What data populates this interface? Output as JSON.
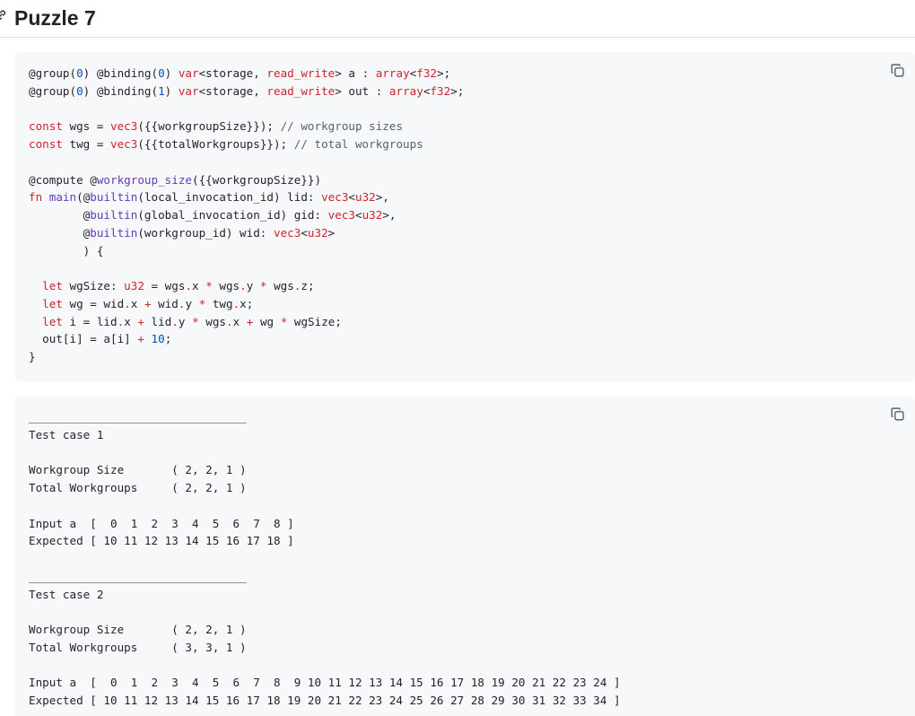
{
  "page": {
    "title": "Puzzle 7"
  },
  "icons": {
    "anchor": "link-icon",
    "copy": "copy-icon"
  },
  "colors": {
    "code_bg": "#f6f8fa",
    "keyword": "#cf222e",
    "function": "#6639ba",
    "comment": "#57606a",
    "number": "#0550ae"
  },
  "code_block_1": {
    "lines": {
      "l1a": "@group(",
      "l1b": "0",
      "l1c": ") @binding(",
      "l1d": "0",
      "l1e": ") ",
      "l1f": "var",
      "l1g": "<storage, ",
      "l1h": "read_write",
      "l1i": "> a : ",
      "l1j": "array",
      "l1k": "<",
      "l1l": "f32",
      "l1m": ">;",
      "l2a": "@group(",
      "l2b": "0",
      "l2c": ") @binding(",
      "l2d": "1",
      "l2e": ") ",
      "l2f": "var",
      "l2g": "<storage, ",
      "l2h": "read_write",
      "l2i": "> out : ",
      "l2j": "array",
      "l2k": "<",
      "l2l": "f32",
      "l2m": ">;",
      "l4a": "const",
      "l4b": " wgs = ",
      "l4c": "vec3",
      "l4d": "({{workgroupSize}}); ",
      "l4e": "// workgroup sizes",
      "l5a": "const",
      "l5b": " twg = ",
      "l5c": "vec3",
      "l5d": "({{totalWorkgroups}}); ",
      "l5e": "// total workgroups",
      "l7a": "@compute @",
      "l7b": "workgroup_size",
      "l7c": "({{workgroupSize}})",
      "l8a": "fn",
      "l8b": " ",
      "l8c": "main",
      "l8d": "(@",
      "l8e": "builtin",
      "l8f": "(local_invocation_id) lid: ",
      "l8g": "vec3",
      "l8h": "<",
      "l8i": "u32",
      "l8j": ">,",
      "l9a": "        @",
      "l9b": "builtin",
      "l9c": "(global_invocation_id) gid: ",
      "l9d": "vec3",
      "l9e": "<",
      "l9f": "u32",
      "l9g": ">,",
      "l10a": "        @",
      "l10b": "builtin",
      "l10c": "(workgroup_id) wid: ",
      "l10d": "vec3",
      "l10e": "<",
      "l10f": "u32",
      "l10g": ">",
      "l11": "        ) {",
      "l13a": "  ",
      "l13b": "let",
      "l13c": " wgSize: ",
      "l13d": "u32",
      "l13e": " = wgs",
      "l13f": ".",
      "l13g": "x ",
      "l13h": "*",
      "l13i": " wgs",
      "l13j": ".",
      "l13k": "y ",
      "l13l": "*",
      "l13m": " wgs",
      "l13n": ".",
      "l13o": "z;",
      "l14a": "  ",
      "l14b": "let",
      "l14c": " wg = wid",
      "l14d": ".",
      "l14e": "x ",
      "l14f": "+",
      "l14g": " wid",
      "l14h": ".",
      "l14i": "y ",
      "l14j": "*",
      "l14k": " twg",
      "l14l": ".",
      "l14m": "x;",
      "l15a": "  ",
      "l15b": "let",
      "l15c": " i = lid",
      "l15d": ".",
      "l15e": "x ",
      "l15f": "+",
      "l15g": " lid",
      "l15h": ".",
      "l15i": "y ",
      "l15j": "*",
      "l15k": " wgs",
      "l15l": ".",
      "l15m": "x ",
      "l15n": "+",
      "l15o": " wg ",
      "l15p": "*",
      "l15q": " wgSize;",
      "l16a": "  out[i] = a[i] ",
      "l16b": "+",
      "l16c": " ",
      "l16d": "10",
      "l16e": ";",
      "l17": "}"
    }
  },
  "code_block_2": {
    "text": "________________________________\nTest case 1\n\nWorkgroup Size       ( 2, 2, 1 )\nTotal Workgroups     ( 2, 2, 1 )\n\nInput a  [  0  1  2  3  4  5  6  7  8 ]\nExpected [ 10 11 12 13 14 15 16 17 18 ]\n\n________________________________\nTest case 2\n\nWorkgroup Size       ( 2, 2, 1 )\nTotal Workgroups     ( 3, 3, 1 )\n\nInput a  [  0  1  2  3  4  5  6  7  8  9 10 11 12 13 14 15 16 17 18 19 20 21 22 23 24 ]\nExpected [ 10 11 12 13 14 15 16 17 18 19 20 21 22 23 24 25 26 27 28 29 30 31 32 33 34 ]"
  }
}
